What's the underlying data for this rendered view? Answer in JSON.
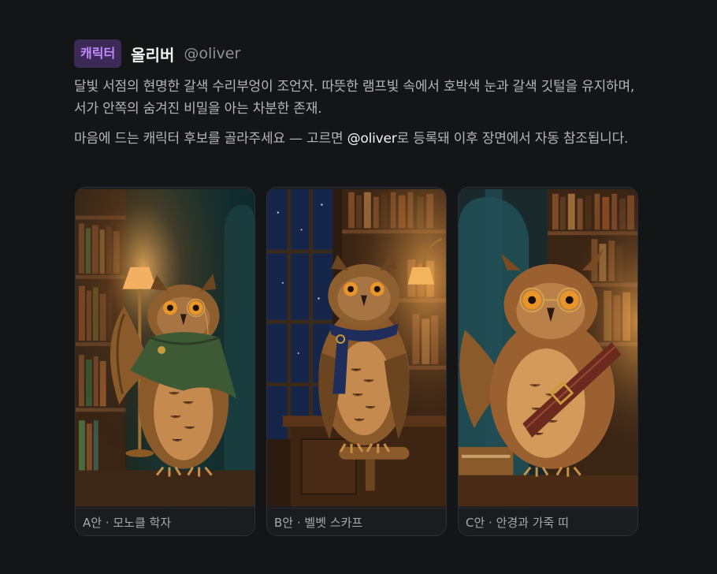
{
  "post": {
    "badge": "캐릭터",
    "name": "올리버",
    "handle": "@oliver",
    "description": "달빛 서점의 현명한 갈색 수리부엉이 조언자. 따뜻한 램프빛 속에서 호박색 눈과 갈색 깃털을 유지하며, 서가 안쪽의 숨겨진 비밀을 아는 차분한 존재.",
    "instruction_before": "마음에 드는 캐릭터 후보를 골라주세요 — 고르면 ",
    "instruction_mention": "@oliver",
    "instruction_after": "로 등록돼 이후 장면에서 자동 참조됩니다."
  },
  "options": [
    {
      "caption": "A안 · 모노클 학자",
      "image": "owl-with-green-cloak-and-monocle"
    },
    {
      "caption": "B안 · 벨벳 스카프",
      "image": "owl-with-navy-velvet-scarf"
    },
    {
      "caption": "C안 · 안경과 가죽 띠",
      "image": "owl-with-glasses-and-leather-strap"
    }
  ],
  "colors": {
    "background": "#141517",
    "badge_bg": "#3a2a55",
    "badge_text": "#c28bff",
    "amber": "#e8962a",
    "owl_brown": "#8a5a2b"
  }
}
